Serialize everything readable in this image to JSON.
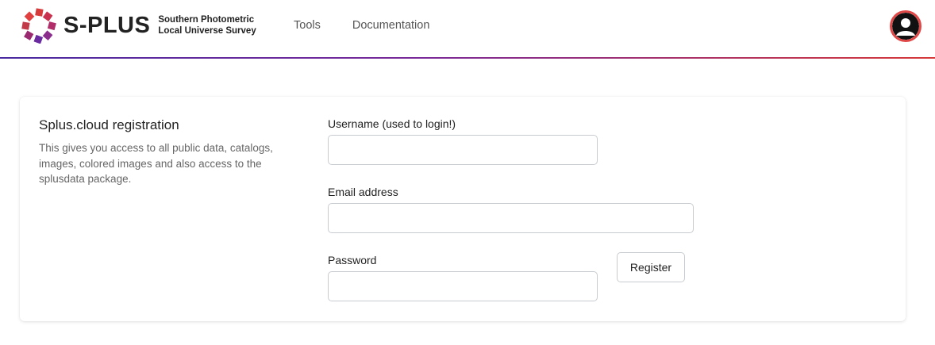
{
  "brand": {
    "name": "S-PLUS",
    "subtitle_line1": "Southern Photometric",
    "subtitle_line2": "Local Universe Survey"
  },
  "nav": {
    "links": [
      "Tools",
      "Documentation"
    ]
  },
  "user_menu": {
    "icon": "user-avatar-icon"
  },
  "colors": {
    "accent_red": "#e04848",
    "gradient_start": "#4a2aa0",
    "gradient_end": "#d63a3a"
  },
  "registration": {
    "title": "Splus.cloud registration",
    "description": "This gives you access to all public data, catalogs, images, colored images and also access to the splusdata package.",
    "fields": {
      "username": {
        "label": "Username (used to login!)",
        "value": ""
      },
      "email": {
        "label": "Email address",
        "value": ""
      },
      "password": {
        "label": "Password",
        "value": ""
      }
    },
    "submit_label": "Register"
  }
}
